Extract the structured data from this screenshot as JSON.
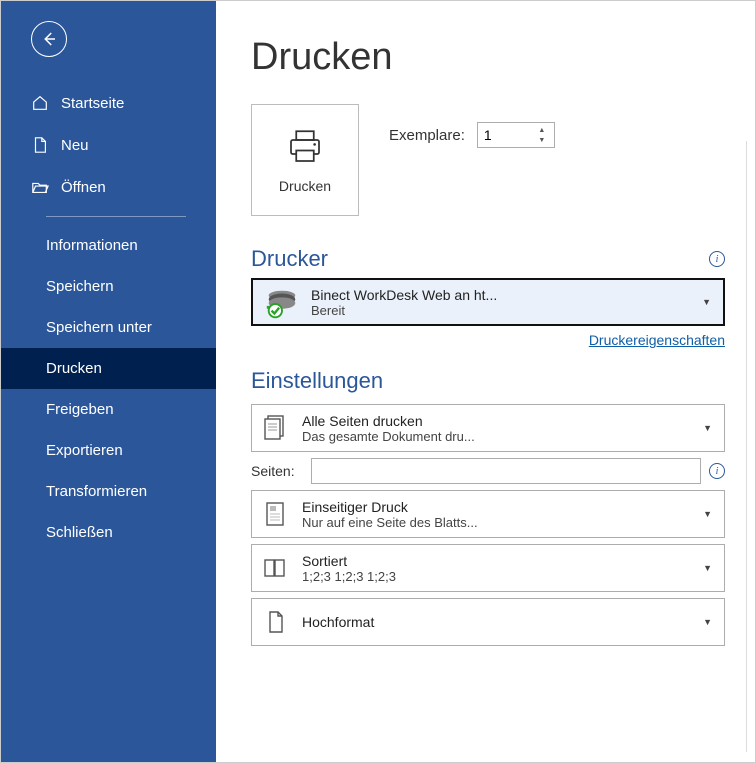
{
  "sidebar": {
    "top": [
      {
        "label": "Startseite"
      },
      {
        "label": "Neu"
      },
      {
        "label": "Öffnen"
      }
    ],
    "items": [
      {
        "label": "Informationen"
      },
      {
        "label": "Speichern"
      },
      {
        "label": "Speichern unter"
      },
      {
        "label": "Drucken"
      },
      {
        "label": "Freigeben"
      },
      {
        "label": "Exportieren"
      },
      {
        "label": "Transformieren"
      },
      {
        "label": "Schließen"
      }
    ]
  },
  "page": {
    "title": "Drucken"
  },
  "print": {
    "button_label": "Drucken",
    "copies_label": "Exemplare:",
    "copies_value": "1"
  },
  "printer": {
    "section_title": "Drucker",
    "name": "Binect WorkDesk Web an ht...",
    "status": "Bereit",
    "properties_link": "Druckereigenschaften"
  },
  "settings": {
    "title": "Einstellungen",
    "pages_label": "Seiten:",
    "pages_value": "",
    "items": [
      {
        "line1": "Alle Seiten drucken",
        "line2": "Das gesamte Dokument dru..."
      },
      {
        "line1": "Einseitiger Druck",
        "line2": "Nur auf eine Seite des Blatts..."
      },
      {
        "line1": "Sortiert",
        "line2": "1;2;3    1;2;3    1;2;3"
      },
      {
        "line1": "Hochformat",
        "line2": ""
      }
    ]
  }
}
